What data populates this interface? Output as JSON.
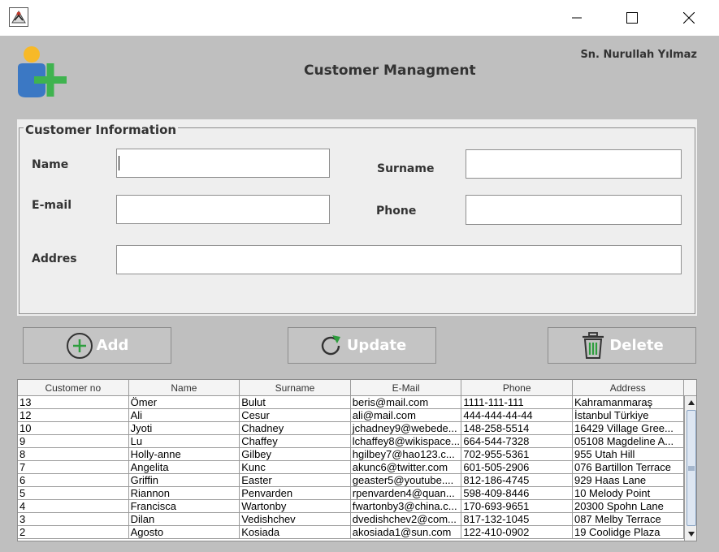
{
  "window": {
    "icon": "java-cup-icon",
    "controls": {
      "minimize": "minimize-icon",
      "maximize": "maximize-icon",
      "close": "close-icon"
    }
  },
  "header": {
    "title": "Customer Managment",
    "user": "Sn. Nurullah Yılmaz",
    "logo": "add-user-icon"
  },
  "form": {
    "legend": "Customer Information",
    "name_label": "Name",
    "surname_label": "Surname",
    "email_label": "E-mail",
    "phone_label": "Phone",
    "address_label": "Addres",
    "name_value": "",
    "surname_value": "",
    "email_value": "",
    "phone_value": "",
    "address_value": ""
  },
  "actions": {
    "add": "Add",
    "update": "Update",
    "delete": "Delete"
  },
  "table": {
    "columns": [
      "Customer no",
      "Name",
      "Surname",
      "E-Mail",
      "Phone",
      "Address"
    ],
    "rows": [
      [
        "13",
        "Ömer",
        "Bulut",
        "beris@mail.com",
        "1111-111-111",
        "Kahramanmaraş"
      ],
      [
        "12",
        "Ali",
        "Cesur",
        "ali@mail.com",
        "444-444-44-44",
        "İstanbul Türkiye"
      ],
      [
        "10",
        "Jyoti",
        "Chadney",
        "jchadney9@webede...",
        "148-258-5514",
        "16429 Village Gree..."
      ],
      [
        "9",
        "Lu",
        "Chaffey",
        "lchaffey8@wikispace...",
        "664-544-7328",
        "05108 Magdeline A..."
      ],
      [
        "8",
        "Holly-anne",
        "Gilbey",
        "hgilbey7@hao123.c...",
        "702-955-5361",
        "955 Utah Hill"
      ],
      [
        "7",
        "Angelita",
        "Kunc",
        "akunc6@twitter.com",
        "601-505-2906",
        "076 Bartillon Terrace"
      ],
      [
        "6",
        "Griffin",
        "Easter",
        "geaster5@youtube....",
        "812-186-4745",
        "929 Haas Lane"
      ],
      [
        "5",
        "Riannon",
        "Penvarden",
        "rpenvarden4@quan...",
        "598-409-8446",
        "10 Melody Point"
      ],
      [
        "4",
        "Francisca",
        "Wartonby",
        "fwartonby3@china.c...",
        "170-693-9651",
        "20300 Spohn Lane"
      ],
      [
        "3",
        "Dilan",
        "Vedishchev",
        "dvedishchev2@com...",
        "817-132-1045",
        "087 Melby Terrace"
      ],
      [
        "2",
        "Agosto",
        "Kosiada",
        "akosiada1@sun.com",
        "122-410-0902",
        "19 Coolidge Plaza"
      ]
    ]
  },
  "colors": {
    "window_bg": "#bfbfbf",
    "panel_bg": "#eeeeee",
    "add_icon": "#2e9e3e",
    "update_icon": "#2e9e3e",
    "delete_icon": "#2e9e3e",
    "logo_person_head": "#f7b928",
    "logo_person_body": "#3b78c4",
    "logo_plus": "#3fb34f"
  }
}
